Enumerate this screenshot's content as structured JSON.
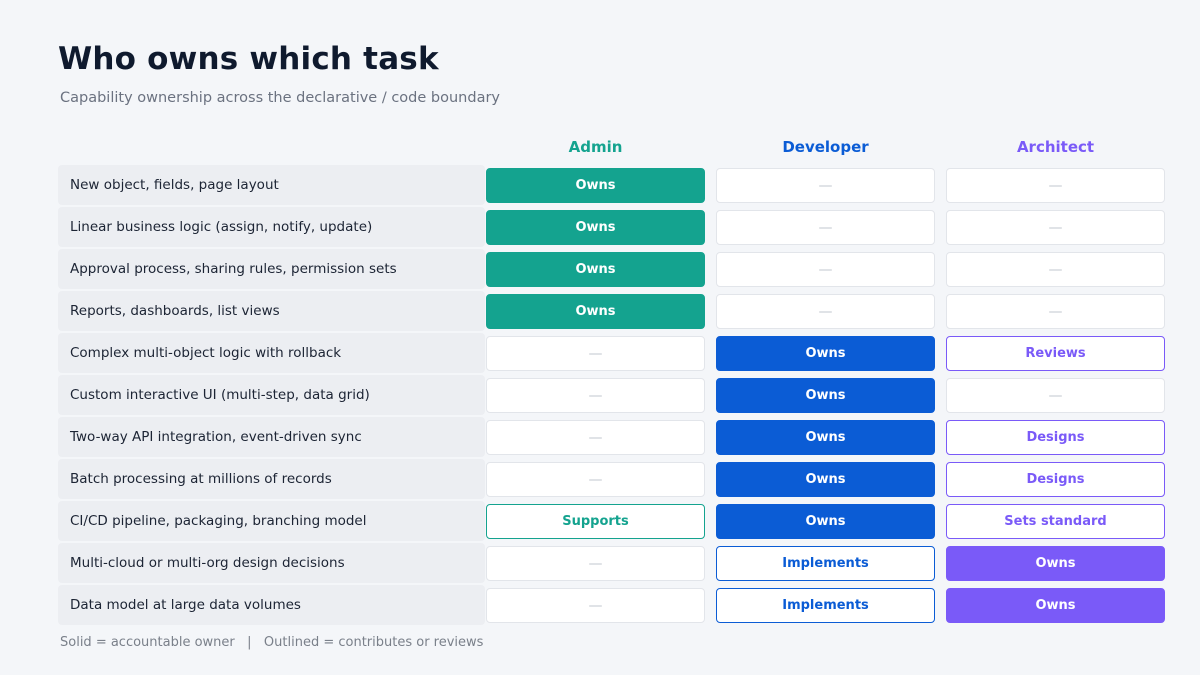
{
  "title": "Who owns which task",
  "subtitle": "Capability ownership across the declarative / code boundary",
  "columns": [
    {
      "label": "Admin",
      "color": "#14a38f"
    },
    {
      "label": "Developer",
      "color": "#0b5cd5"
    },
    {
      "label": "Architect",
      "color": "#7a5af8"
    }
  ],
  "empty_symbol": "—",
  "rows": [
    {
      "task": "New object, fields, page layout",
      "cells": [
        {
          "style": "solid",
          "text": "Owns"
        },
        {
          "style": "empty",
          "text": ""
        },
        {
          "style": "empty",
          "text": ""
        }
      ]
    },
    {
      "task": "Linear business logic (assign, notify, update)",
      "cells": [
        {
          "style": "solid",
          "text": "Owns"
        },
        {
          "style": "empty",
          "text": ""
        },
        {
          "style": "empty",
          "text": ""
        }
      ]
    },
    {
      "task": "Approval process, sharing rules, permission sets",
      "cells": [
        {
          "style": "solid",
          "text": "Owns"
        },
        {
          "style": "empty",
          "text": ""
        },
        {
          "style": "empty",
          "text": ""
        }
      ]
    },
    {
      "task": "Reports, dashboards, list views",
      "cells": [
        {
          "style": "solid",
          "text": "Owns"
        },
        {
          "style": "empty",
          "text": ""
        },
        {
          "style": "empty",
          "text": ""
        }
      ]
    },
    {
      "task": "Complex multi-object logic with rollback",
      "cells": [
        {
          "style": "empty",
          "text": ""
        },
        {
          "style": "solid",
          "text": "Owns"
        },
        {
          "style": "outline",
          "text": "Reviews"
        }
      ]
    },
    {
      "task": "Custom interactive UI (multi-step, data grid)",
      "cells": [
        {
          "style": "empty",
          "text": ""
        },
        {
          "style": "solid",
          "text": "Owns"
        },
        {
          "style": "empty",
          "text": ""
        }
      ]
    },
    {
      "task": "Two-way API integration, event-driven sync",
      "cells": [
        {
          "style": "empty",
          "text": ""
        },
        {
          "style": "solid",
          "text": "Owns"
        },
        {
          "style": "outline",
          "text": "Designs"
        }
      ]
    },
    {
      "task": "Batch processing at millions of records",
      "cells": [
        {
          "style": "empty",
          "text": ""
        },
        {
          "style": "solid",
          "text": "Owns"
        },
        {
          "style": "outline",
          "text": "Designs"
        }
      ]
    },
    {
      "task": "CI/CD pipeline, packaging, branching model",
      "cells": [
        {
          "style": "outline",
          "text": "Supports"
        },
        {
          "style": "solid",
          "text": "Owns"
        },
        {
          "style": "outline",
          "text": "Sets standard"
        }
      ]
    },
    {
      "task": "Multi-cloud or multi-org design decisions",
      "cells": [
        {
          "style": "empty",
          "text": ""
        },
        {
          "style": "outline",
          "text": "Implements"
        },
        {
          "style": "solid",
          "text": "Owns"
        }
      ]
    },
    {
      "task": "Data model at large data volumes",
      "cells": [
        {
          "style": "empty",
          "text": ""
        },
        {
          "style": "outline",
          "text": "Implements"
        },
        {
          "style": "solid",
          "text": "Owns"
        }
      ]
    }
  ],
  "legend": "Solid = accountable owner   |   Outlined = contributes or reviews"
}
